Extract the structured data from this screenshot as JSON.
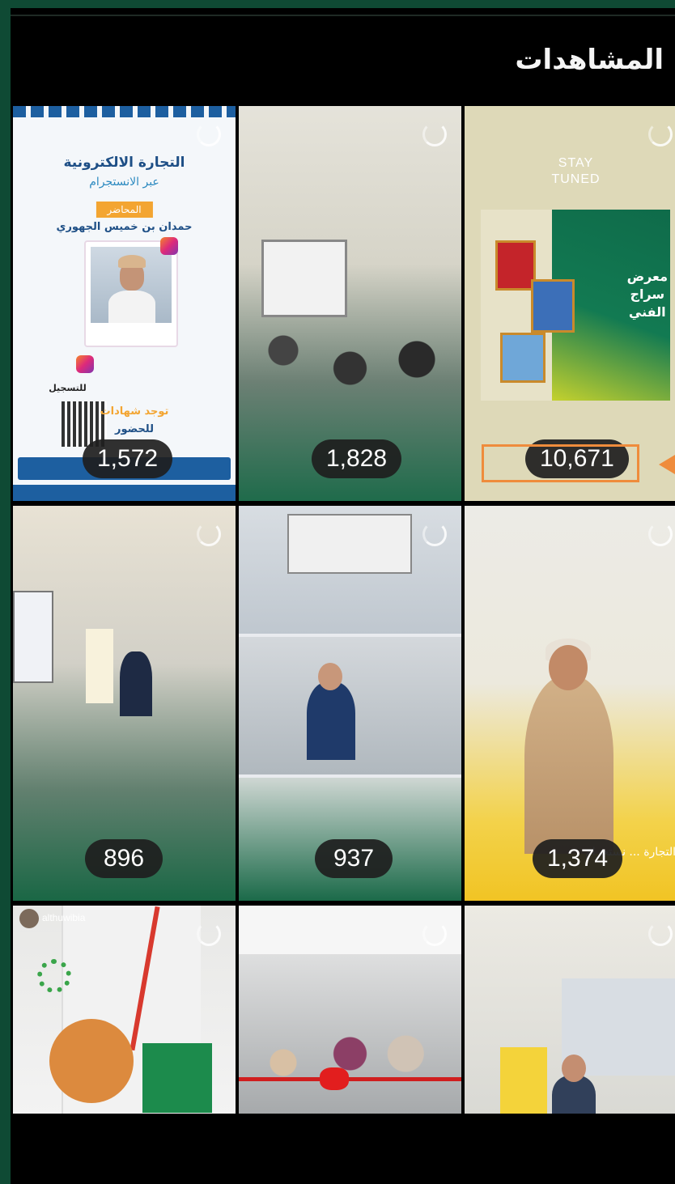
{
  "header": {
    "title": "المشاهدات"
  },
  "tiles": [
    {
      "views": "1,572",
      "poster_title": "التجارة الالكترونية",
      "poster_sub": "عبر الانستجرام",
      "poster_tag": "المحاضر",
      "poster_name": "حمدان بن خميس الجهوري",
      "poster_register": "للتسجيل",
      "poster_cert": "توجد شهادات",
      "poster_attend": "للحضور"
    },
    {
      "views": "1,828"
    },
    {
      "views": "10,671",
      "stay": "STAY",
      "tuned": "TUNED",
      "expo_line1": "معرض",
      "expo_line2": "سراج",
      "expo_line3": "الفني",
      "highlighted": true
    },
    {
      "views": "896"
    },
    {
      "views": "937"
    },
    {
      "views": "1,374",
      "caption": "التجارة ... نستجرام"
    },
    {
      "username": "althuwibia"
    },
    {},
    {}
  ],
  "colors": {
    "accent": "#ef8c3c",
    "frame": "#0f4a34",
    "pill_bg": "#1e1e1e"
  }
}
